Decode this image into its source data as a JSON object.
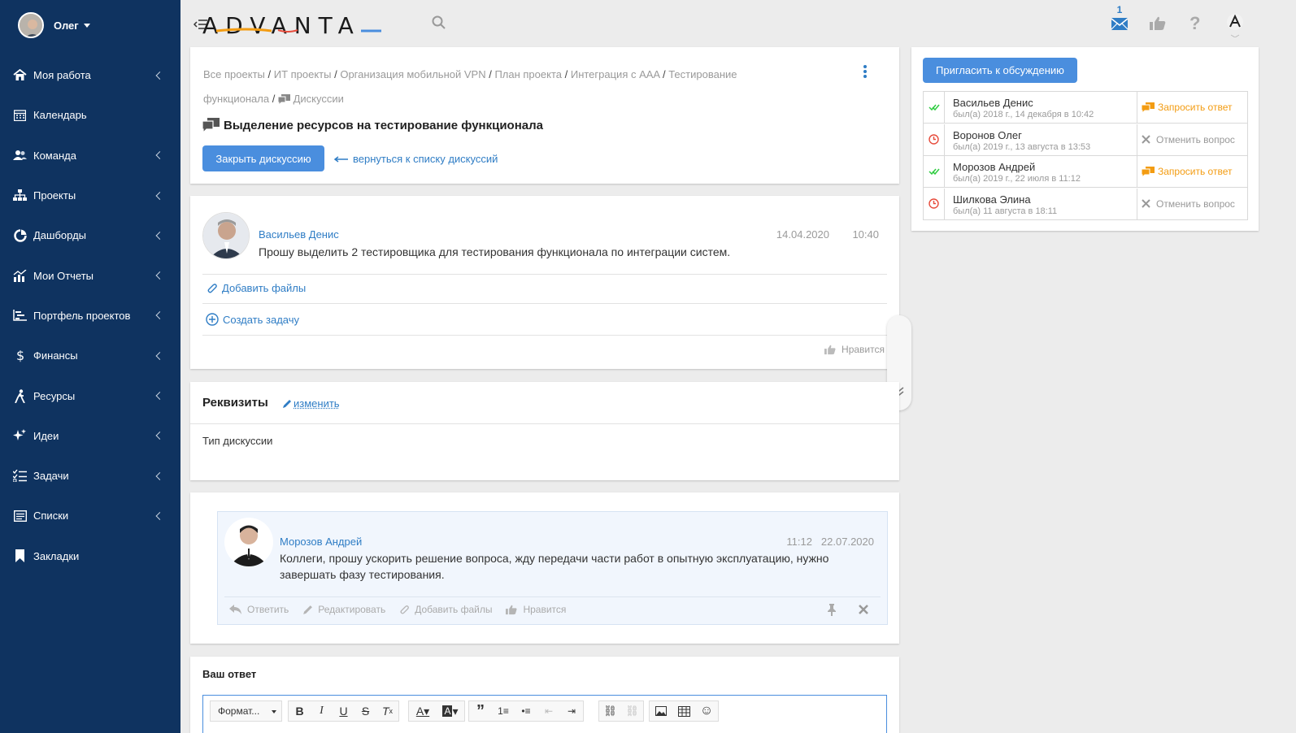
{
  "user": {
    "name": "Олег"
  },
  "sidebar": {
    "items": [
      {
        "label": "Моя работа",
        "icon": "home-icon",
        "has_arrow": true
      },
      {
        "label": "Календарь",
        "icon": "calendar-icon",
        "has_arrow": false
      },
      {
        "label": "Команда",
        "icon": "team-icon",
        "has_arrow": true
      },
      {
        "label": "Проекты",
        "icon": "projects-icon",
        "has_arrow": true
      },
      {
        "label": "Дашборды",
        "icon": "dashboard-icon",
        "has_arrow": true
      },
      {
        "label": "Мои Отчеты",
        "icon": "reports-icon",
        "has_arrow": true
      },
      {
        "label": "Портфель проектов",
        "icon": "portfolio-icon",
        "has_arrow": true
      },
      {
        "label": "Финансы",
        "icon": "dollar-icon",
        "has_arrow": true
      },
      {
        "label": "Ресурсы",
        "icon": "resources-icon",
        "has_arrow": true
      },
      {
        "label": "Идеи",
        "icon": "ideas-icon",
        "has_arrow": true
      },
      {
        "label": "Задачи",
        "icon": "tasks-icon",
        "has_arrow": true
      },
      {
        "label": "Списки",
        "icon": "lists-icon",
        "has_arrow": true
      },
      {
        "label": "Закладки",
        "icon": "bookmark-icon",
        "has_arrow": false
      }
    ]
  },
  "topbar": {
    "logo": "ADVANTA",
    "mail_count": "1"
  },
  "header": {
    "breadcrumbs": [
      "Все проекты",
      "ИТ проекты",
      "Организация мобильной VPN",
      "План проекта",
      "Интеграция с AAA",
      "Тестирование функционала"
    ],
    "breadcrumb_last": "Дискуссии",
    "title": "Выделение ресурсов на тестирование функционала",
    "close_button": "Закрыть дискуссию",
    "back_link": "вернуться к списку дискуссий"
  },
  "post": {
    "author": "Васильев Денис",
    "date": "14.04.2020",
    "time": "10:40",
    "text": "Прошу выделить 2 тестировщика для тестирования функционала по интеграции систем.",
    "add_files": "Добавить файлы",
    "create_task": "Создать задачу",
    "like": "Нравится"
  },
  "requisites": {
    "title": "Реквизиты",
    "edit": "изменить",
    "field_label": "Тип дискуссии"
  },
  "comment": {
    "author": "Морозов Андрей",
    "time": "11:12",
    "date": "22.07.2020",
    "text": "Коллеги, прошу ускорить решение вопроса, жду передачи части работ в опытную эксплуатацию, нужно завершать фазу тестирования.",
    "reply": "Ответить",
    "edit": "Редактировать",
    "add_files": "Добавить файлы",
    "like": "Нравится"
  },
  "reply": {
    "title": "Ваш ответ",
    "format_label": "Формат..."
  },
  "participants": {
    "invite_button": "Пригласить к обсуждению",
    "rows": [
      {
        "name": "Васильев Денис",
        "seen": "был(а) 2018 г., 14 декабря в 10:42",
        "status": "check",
        "action": "Запросить ответ",
        "action_type": "request"
      },
      {
        "name": "Воронов Олег",
        "seen": "был(а) 2019 г., 13 августа в 13:53",
        "status": "clock",
        "action": "Отменить вопрос",
        "action_type": "cancel"
      },
      {
        "name": "Морозов Андрей",
        "seen": "был(а) 2019 г., 22 июля в 11:12",
        "status": "check",
        "action": "Запросить ответ",
        "action_type": "request"
      },
      {
        "name": "Шилкова Элина",
        "seen": "был(а) 11 августа в 18:11",
        "status": "clock",
        "action": "Отменить вопрос",
        "action_type": "cancel"
      }
    ]
  },
  "colors": {
    "sidebar": "#0f3360",
    "accent": "#4a8ede",
    "link": "#2f7dc5",
    "orange": "#f39c12",
    "green": "#2ecc40",
    "red": "#e74c3c"
  }
}
